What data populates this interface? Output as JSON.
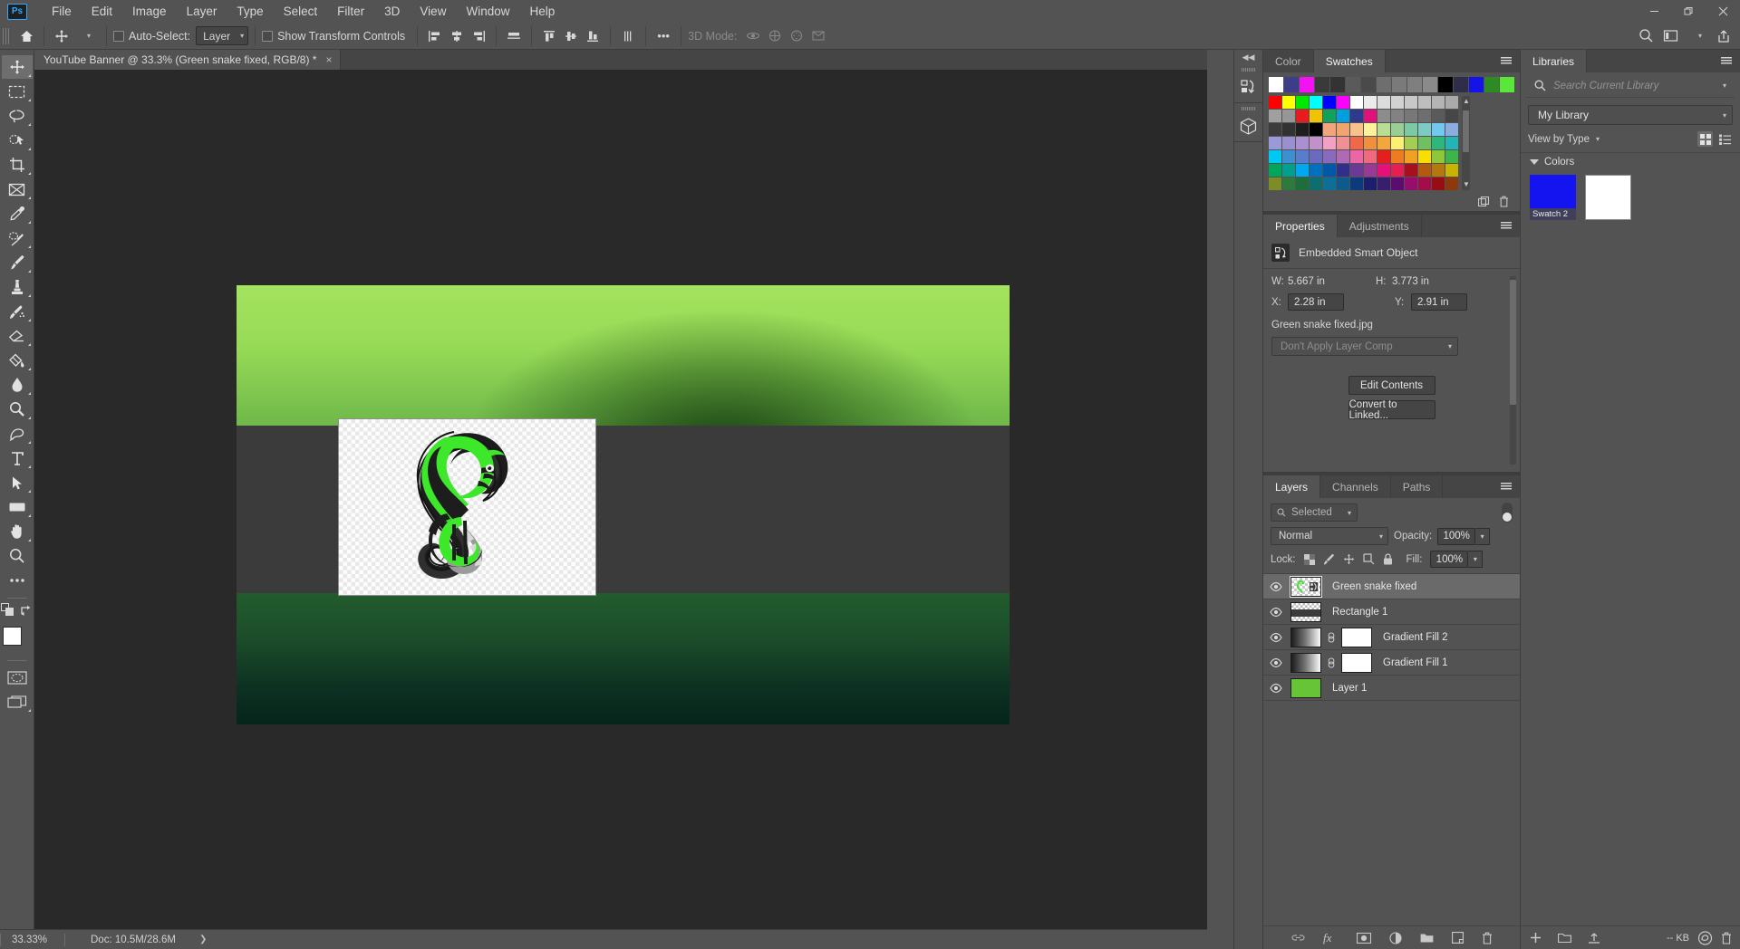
{
  "app": {
    "logo": "Ps"
  },
  "menubar": {
    "items": [
      "File",
      "Edit",
      "Image",
      "Layer",
      "Type",
      "Select",
      "Filter",
      "3D",
      "View",
      "Window",
      "Help"
    ],
    "window_controls": [
      "minimize",
      "restore",
      "close"
    ]
  },
  "options_bar": {
    "home_icon": "home-icon",
    "tool_icon": "move-tool-icon",
    "auto_select_label": "Auto-Select:",
    "auto_select_checked": false,
    "auto_select_scope": "Layer",
    "show_transform_label": "Show Transform Controls",
    "show_transform_checked": false,
    "more_label": "•••",
    "mode_3d_label": "3D Mode:",
    "right_icons": [
      "search-icon",
      "workspace-icon",
      "chevron-down-icon",
      "share-icon"
    ]
  },
  "document": {
    "tab_title": "YouTube Banner @ 33.3% (Green snake fixed, RGB/8) *",
    "close_glyph": "×"
  },
  "toolbar": {
    "tools": [
      {
        "name": "move-tool",
        "active": true
      },
      {
        "name": "rectangular-marquee-tool",
        "active": false
      },
      {
        "name": "lasso-tool",
        "active": false
      },
      {
        "name": "object-selection-tool",
        "active": false
      },
      {
        "name": "crop-tool",
        "active": false
      },
      {
        "name": "frame-tool",
        "active": false
      },
      {
        "name": "eyedropper-tool",
        "active": false
      },
      {
        "name": "spot-healing-brush-tool",
        "active": false
      },
      {
        "name": "brush-tool",
        "active": false
      },
      {
        "name": "clone-stamp-tool",
        "active": false
      },
      {
        "name": "history-brush-tool",
        "active": false
      },
      {
        "name": "eraser-tool",
        "active": false
      },
      {
        "name": "gradient-tool",
        "active": false
      },
      {
        "name": "blur-tool",
        "active": false
      },
      {
        "name": "dodge-tool",
        "active": false
      },
      {
        "name": "pen-tool",
        "active": false
      },
      {
        "name": "type-tool",
        "active": false
      },
      {
        "name": "path-selection-tool",
        "active": false
      },
      {
        "name": "rectangle-tool",
        "active": false
      },
      {
        "name": "hand-tool",
        "active": false
      },
      {
        "name": "zoom-tool",
        "active": false
      },
      {
        "name": "edit-toolbar-tool",
        "active": false
      }
    ],
    "foreground_color": "#ffffff",
    "background_color": "#a8e05f",
    "quick_mask_name": "quick-mask-icon",
    "screen_mode_name": "screen-mode-icon"
  },
  "canvas": {
    "artboard": {
      "top_band_colors": [
        "#a4e35e",
        "#6fb84a"
      ],
      "mid_band_color": "#3b3b3b",
      "bottom_band_colors": [
        "#225c2d",
        "#06251c"
      ],
      "smart_object_label": "green-snake-graphic"
    }
  },
  "status_bar": {
    "zoom": "33.33%",
    "doc": "Doc: 10.5M/28.6M",
    "arrow": "❯"
  },
  "mini_dock": {
    "collapse_glyph": "◀◀",
    "buttons": [
      "history-panel-icon",
      "3d-panel-icon"
    ]
  },
  "swatches_panel": {
    "tabs": [
      {
        "label": "Color",
        "active": false
      },
      {
        "label": "Swatches",
        "active": true
      }
    ],
    "recent": [
      "#ffffff",
      "#3d3d8a",
      "#f312f3",
      "#3a3a3a",
      "#333333",
      "#5a5a5a",
      "#4a4a4a",
      "#6e6e6e",
      "#7a7a7a",
      "#7f7f7f",
      "#8a8a8a",
      "#000000",
      "#2e2e48",
      "#1414e8",
      "#2e8b23",
      "#57e838"
    ],
    "grid": [
      "#ff0000",
      "#ffff00",
      "#00e800",
      "#00ffff",
      "#0000ff",
      "#ff00ff",
      "#ffffff",
      "#ebebeb",
      "#dcdcdc",
      "#d2d2d2",
      "#c8c8c8",
      "#bebebe",
      "#b4b4b4",
      "#aaaaaa",
      "#a0a0a0",
      "#969696",
      "#e81c1c",
      "#f0c400",
      "#12a05a",
      "#00a0e0",
      "#2e3a8c",
      "#e0117a",
      "#8c8c8c",
      "#828282",
      "#787878",
      "#6e6e6e",
      "#5a5a5a",
      "#464646",
      "#3c3c3c",
      "#323232",
      "#1e1e1e",
      "#000000",
      "#f0a57a",
      "#f0a570",
      "#f7c28c",
      "#fcf29b",
      "#b9dd92",
      "#99cf95",
      "#7cc9a6",
      "#7ccbc4",
      "#73c8f0",
      "#8aaee0",
      "#9a9ad8",
      "#9a8fd0",
      "#ab8fd0",
      "#c291cc",
      "#f2a0c4",
      "#f09093",
      "#f0684a",
      "#f0903c",
      "#f2a63c",
      "#fcf070",
      "#a5cc55",
      "#6fc05f",
      "#2cb87a",
      "#23b5b5",
      "#00c8f0",
      "#3c8fd0",
      "#5a7ccc",
      "#6a6ac0",
      "#8a6aba",
      "#b06ab5",
      "#ea66a5",
      "#f0697f",
      "#e61e1e",
      "#f07a1e",
      "#f2a023",
      "#fade00",
      "#8ec63c",
      "#3cb54a",
      "#00a65a",
      "#00a090",
      "#00a8f0",
      "#0070c0",
      "#0058a8",
      "#30308c",
      "#6a3a96",
      "#9a3a96",
      "#e6107a",
      "#e61e52",
      "#a50f1e",
      "#b5590f",
      "#b5770f",
      "#c8b400",
      "#7c8c28",
      "#2e7a3c",
      "#1e6e3c",
      "#0d6e6e",
      "#0d6e96",
      "#0d5a8c",
      "#0d3a7a",
      "#1e1e6e",
      "#3a1e6e",
      "#5a0d6e",
      "#960d6e",
      "#a50d4a",
      "#960d14",
      "#8c3a0d"
    ],
    "footer_icons": [
      "new-group-icon",
      "delete-swatch-icon"
    ]
  },
  "properties_panel": {
    "tabs": [
      {
        "label": "Properties",
        "active": true
      },
      {
        "label": "Adjustments",
        "active": false
      }
    ],
    "object_type": "Embedded Smart Object",
    "object_icon": "smart-object-icon",
    "width_label": "W:",
    "width_value": "5.667 in",
    "height_label": "H:",
    "height_value": "3.773 in",
    "x_label": "X:",
    "x_value": "2.28 in",
    "y_label": "Y:",
    "y_value": "2.91 in",
    "filename": "Green snake fixed.jpg",
    "layer_comp": "Don't Apply Layer Comp",
    "edit_contents_button": "Edit Contents",
    "convert_to_linked_button": "Convert to Linked..."
  },
  "layers_panel": {
    "tabs": [
      {
        "label": "Layers",
        "active": true
      },
      {
        "label": "Channels",
        "active": false
      },
      {
        "label": "Paths",
        "active": false
      }
    ],
    "filter_placeholder": "Selected",
    "filter_icon": "search-icon",
    "blend_mode": "Normal",
    "opacity_label": "Opacity:",
    "opacity_value": "100%",
    "lock_label": "Lock:",
    "lock_icons": [
      "lock-transparency-icon",
      "lock-image-icon",
      "lock-position-icon",
      "lock-artboard-icon",
      "lock-all-icon"
    ],
    "fill_label": "Fill:",
    "fill_value": "100%",
    "layers": [
      {
        "name": "Green snake fixed",
        "visible": true,
        "selected": true,
        "kind": "smart-object",
        "thumb_color": "#6de03c"
      },
      {
        "name": "Rectangle 1",
        "visible": true,
        "selected": false,
        "kind": "shape",
        "thumb_color": "#3b3b3b"
      },
      {
        "name": "Gradient Fill 2",
        "visible": true,
        "selected": false,
        "kind": "gradient-mask",
        "thumb_color": "#ffffff"
      },
      {
        "name": "Gradient Fill 1",
        "visible": true,
        "selected": false,
        "kind": "gradient-mask",
        "thumb_color": "#ffffff"
      },
      {
        "name": "Layer 1",
        "visible": true,
        "selected": false,
        "kind": "solid",
        "thumb_color": "#66c436"
      }
    ],
    "footer_icons": [
      "link-layers-icon",
      "layer-style-fx-icon",
      "add-mask-icon",
      "adjustment-layer-icon",
      "new-group-icon",
      "new-layer-icon",
      "delete-layer-icon"
    ]
  },
  "libraries_panel": {
    "tabs": [
      {
        "label": "Libraries",
        "active": true
      }
    ],
    "search_placeholder": "Search Current Library",
    "search_icon": "search-icon",
    "library_name": "My Library",
    "view_label": "View by Type",
    "view_icons": [
      "grid-view-icon",
      "list-view-icon"
    ],
    "group_label": "Colors",
    "items": [
      {
        "caption": "Swatch 2",
        "color": "#1414f0"
      },
      {
        "caption": "",
        "color": "#ffffff"
      }
    ],
    "footer_icons": [
      "add-library-icon",
      "library-folder-icon",
      "upload-icon"
    ],
    "footer_size": "-- KB",
    "footer_cloud_icon": "creative-cloud-icon",
    "footer_delete_icon": "trash-icon"
  }
}
